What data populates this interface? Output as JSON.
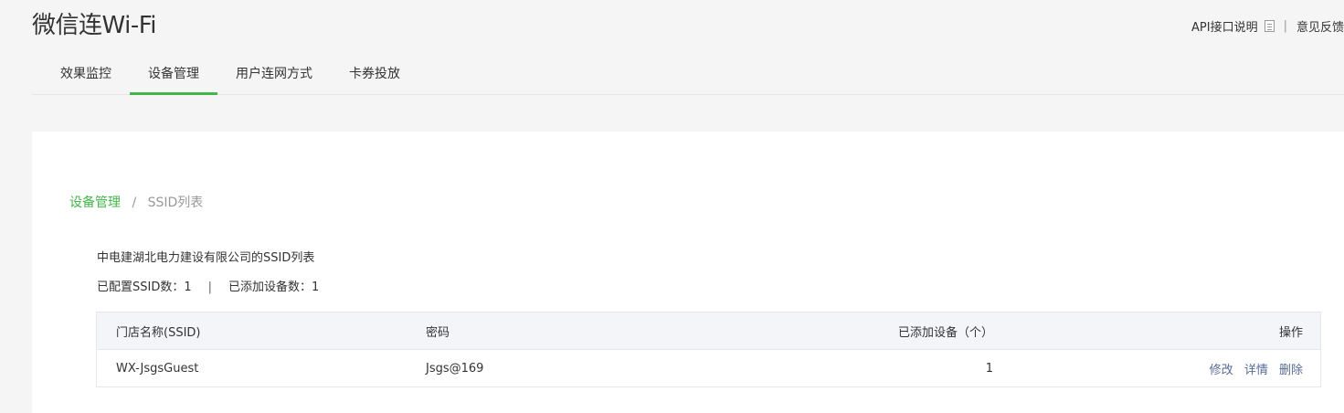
{
  "header": {
    "app_title": "微信连Wi-Fi",
    "api_doc_label": "API接口说明",
    "top_separator": "|",
    "feedback_label": "意见反馈"
  },
  "tabs": [
    {
      "label": "效果监控",
      "active": false
    },
    {
      "label": "设备管理",
      "active": true
    },
    {
      "label": "用户连网方式",
      "active": false
    },
    {
      "label": "卡券投放",
      "active": false
    }
  ],
  "breadcrumb": {
    "parent": "设备管理",
    "separator": "/",
    "current": "SSID列表"
  },
  "list": {
    "title": "中电建湖北电力建设有限公司的SSID列表",
    "configured_label": "已配置SSID数：",
    "configured_count": "1",
    "stats_separator": "|",
    "added_label": "已添加设备数：",
    "added_count": "1"
  },
  "table": {
    "headers": [
      "门店名称(SSID)",
      "密码",
      "已添加设备（个）",
      "操作"
    ],
    "rows": [
      {
        "ssid": "WX-JsgsGuest",
        "password": "Jsgs@169",
        "devices": "1",
        "actions": [
          "修改",
          "详情",
          "删除"
        ]
      }
    ]
  },
  "colors": {
    "accent": "#44b549",
    "link": "#576b95",
    "table_header_bg": "#f4f5f9"
  }
}
